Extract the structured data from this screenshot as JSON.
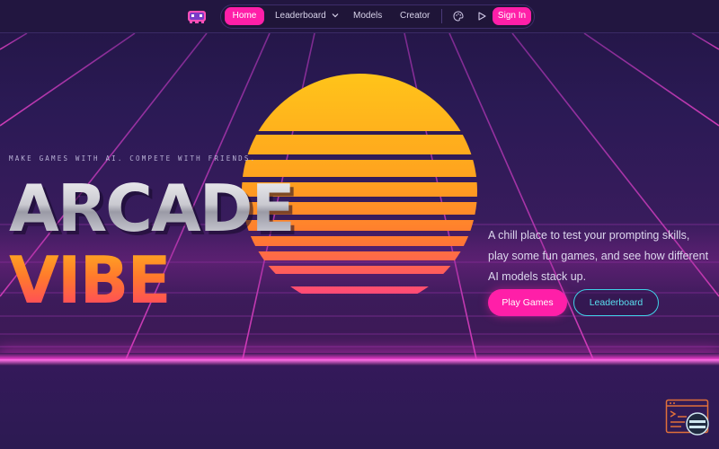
{
  "nav": {
    "logo_icon": "arcade-invader-logo-icon",
    "items": [
      {
        "label": "Home",
        "active": true
      },
      {
        "label": "Leaderboard",
        "has_dropdown": true
      },
      {
        "label": "Models"
      },
      {
        "label": "Creator"
      }
    ],
    "icons": [
      "palette-icon",
      "play-icon"
    ],
    "signin_label": "Sign In"
  },
  "hero": {
    "tagline": "MAKE GAMES WITH AI. COMPETE WITH FRIENDS.",
    "title_line1": "ARCADE",
    "title_line2": "VIBE",
    "description": "A chill place to test your prompting skills, play some fun games, and see how different AI models stack up.",
    "primary_button": "Play Games",
    "secondary_button": "Leaderboard"
  },
  "colors": {
    "accent_pink": "#ff1fa8",
    "accent_cyan": "#3fd3e8",
    "sun_top": "#ffc21a",
    "sun_bottom": "#ff3d8a",
    "background": "#2a1a4e"
  },
  "widget": {
    "icon": "terminal-feedback-icon"
  }
}
